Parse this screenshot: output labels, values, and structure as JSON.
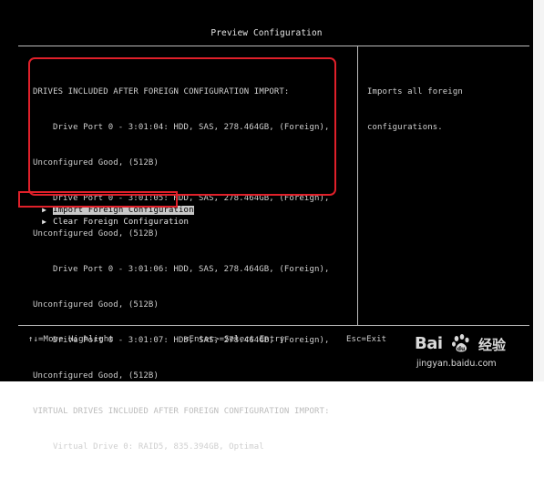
{
  "title": "Preview Configuration",
  "drives": {
    "header": "DRIVES INCLUDED AFTER FOREIGN CONFIGURATION IMPORT:",
    "entries": [
      {
        "line1": "Drive Port 0 - 3:01:04: HDD, SAS, 278.464GB, (Foreign),",
        "line2": "Unconfigured Good, (512B)"
      },
      {
        "line1": "Drive Port 0 - 3:01:05: HDD, SAS, 278.464GB, (Foreign),",
        "line2": "Unconfigured Good, (512B)"
      },
      {
        "line1": "Drive Port 0 - 3:01:06: HDD, SAS, 278.464GB, (Foreign),",
        "line2": "Unconfigured Good, (512B)"
      },
      {
        "line1": "Drive Port 0 - 3:01:07: HDD, SAS, 278.464GB, (Foreign),",
        "line2": "Unconfigured Good, (512B)"
      }
    ]
  },
  "virtual": {
    "header": "VIRTUAL DRIVES INCLUDED AFTER FOREIGN CONFIGURATION IMPORT:",
    "entry": "Virtual Drive 0: RAID5, 835.394GB, Optimal"
  },
  "menu": {
    "import_label": "Import Foreign Configuration",
    "clear_label": "Clear Foreign Configuration"
  },
  "help": {
    "line1": "Imports all foreign",
    "line2": "configurations."
  },
  "footer": {
    "move": "↑↓=Move Highlight",
    "select": "<Enter>=Select Entry",
    "exit": "Esc=Exit"
  },
  "watermark": {
    "brand": "Bai",
    "du_label": "du",
    "cn": "经验",
    "url": "jingyan.baidu.com"
  }
}
